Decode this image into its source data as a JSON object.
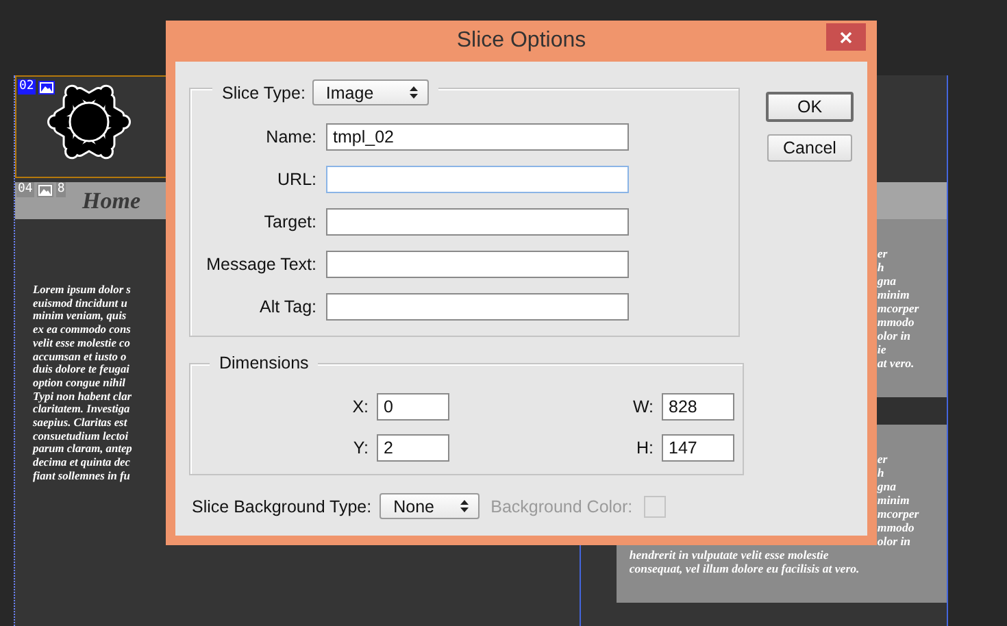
{
  "canvas": {
    "slices": [
      {
        "number": "02",
        "selected": true
      },
      {
        "number": "04",
        "extra": "8",
        "selected": false
      }
    ],
    "nav_label": "Home",
    "left_text": [
      "Lorem ipsum dolor s",
      "euismod tincidunt u",
      "minim veniam, quis",
      "ex ea commodo cons",
      "velit esse molestie co",
      "accumsan et iusto o",
      "duis dolore te feugai",
      "option congue nihil",
      "Typi non habent clar",
      "claritatem. Investiga",
      "saepius. Claritas est",
      "consuetudium lectoi",
      "parum claram, antep",
      "decima et quinta dec",
      "fiant sollemnes in fu"
    ],
    "right_blocks": [
      {
        "lines": [
          {
            "text": "er",
            "kind": "cut"
          },
          {
            "text": "h",
            "kind": "cut"
          },
          {
            "text": "gna",
            "kind": "cut"
          },
          {
            "text": "minim",
            "kind": "cut"
          },
          {
            "text": "mcorper",
            "kind": "cut"
          },
          {
            "text": "mmodo",
            "kind": "cut"
          },
          {
            "text": "olor in",
            "kind": "cut"
          },
          {
            "text": "ie",
            "kind": "cut"
          },
          {
            "text": "at vero.",
            "kind": "cut"
          }
        ]
      },
      {
        "lines": [
          {
            "text": "er",
            "kind": "cut"
          },
          {
            "text": "h",
            "kind": "cut"
          },
          {
            "text": "gna",
            "kind": "cut"
          },
          {
            "text": "minim",
            "kind": "cut"
          },
          {
            "text": "mcorper",
            "kind": "cut"
          },
          {
            "text": "mmodo",
            "kind": "cut"
          },
          {
            "text": "olor in",
            "kind": "cut"
          },
          {
            "text": "hendrerit in vulputate velit esse molestie",
            "kind": "full"
          },
          {
            "text": "consequat, vel illum dolore eu facilisis at vero.",
            "kind": "full"
          }
        ]
      }
    ]
  },
  "dialog": {
    "title": "Slice Options",
    "slice_type": {
      "label": "Slice Type:",
      "value": "Image"
    },
    "fields": [
      {
        "label": "Name:",
        "value": "tmpl_02",
        "focused": false
      },
      {
        "label": "URL:",
        "focused": true
      },
      {
        "label": "Target:",
        "focused": false
      },
      {
        "label": "Message Text:",
        "focused": false
      },
      {
        "label": "Alt Tag:",
        "focused": false
      }
    ],
    "dimensions": {
      "title": "Dimensions",
      "fields": [
        {
          "label": "X:",
          "value": "0"
        },
        {
          "label": "W:",
          "value": "828"
        },
        {
          "label": "Y:",
          "value": "2"
        },
        {
          "label": "H:",
          "value": "147"
        }
      ]
    },
    "background": {
      "label": "Slice Background Type:",
      "value": "None",
      "color_label": "Background Color:",
      "disabled": true
    },
    "buttons": [
      {
        "label": "OK",
        "default": true
      },
      {
        "label": "Cancel",
        "default": false
      }
    ]
  }
}
